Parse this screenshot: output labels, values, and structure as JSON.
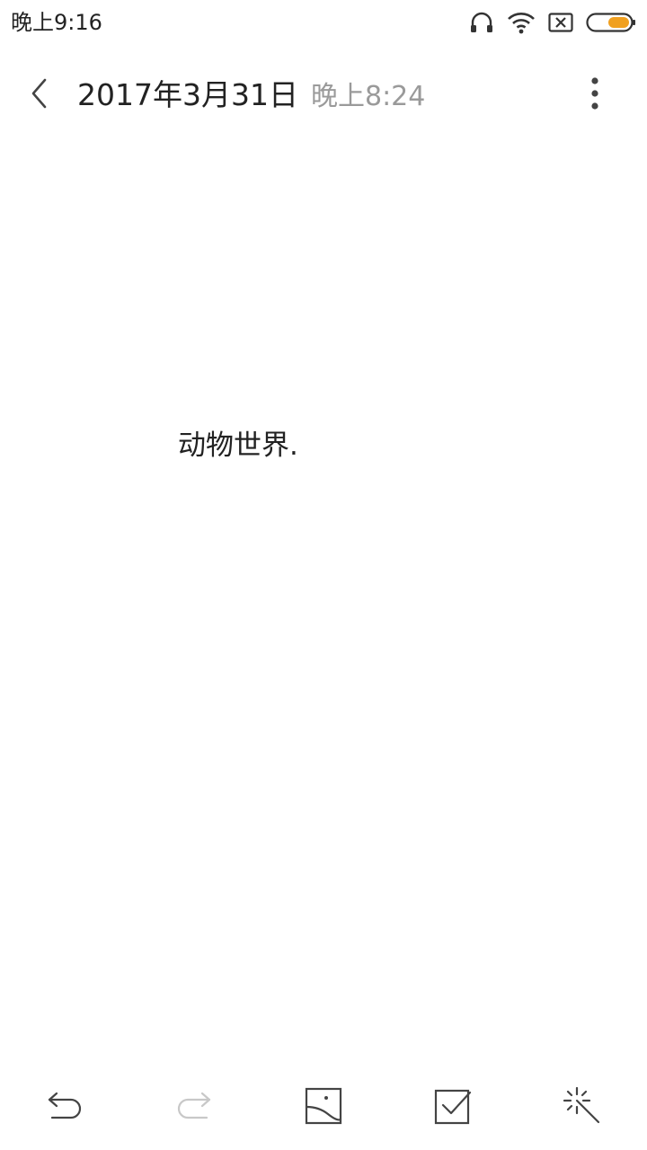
{
  "status_bar": {
    "time": "晚上9:16",
    "icons": [
      "headphones-icon",
      "wifi-icon",
      "sim-none-icon",
      "battery-icon"
    ],
    "battery_color": "#f0a020"
  },
  "header": {
    "date": "2017年3月31日",
    "time": "晚上8:24",
    "back_icon": "chevron-left-icon",
    "more_icon": "more-vertical-icon"
  },
  "note": {
    "content": "动物世界."
  },
  "toolbar": {
    "items": [
      {
        "name": "undo",
        "icon": "undo-icon",
        "enabled": true
      },
      {
        "name": "redo",
        "icon": "redo-icon",
        "enabled": false
      },
      {
        "name": "insert-image",
        "icon": "image-icon",
        "enabled": true
      },
      {
        "name": "checklist",
        "icon": "checkbox-icon",
        "enabled": true
      },
      {
        "name": "magic",
        "icon": "magic-wand-icon",
        "enabled": true
      }
    ]
  },
  "colors": {
    "text_primary": "#222222",
    "text_secondary": "#9a9a9a",
    "icon_disabled": "#c8c8c8",
    "accent": "#f0a020"
  }
}
